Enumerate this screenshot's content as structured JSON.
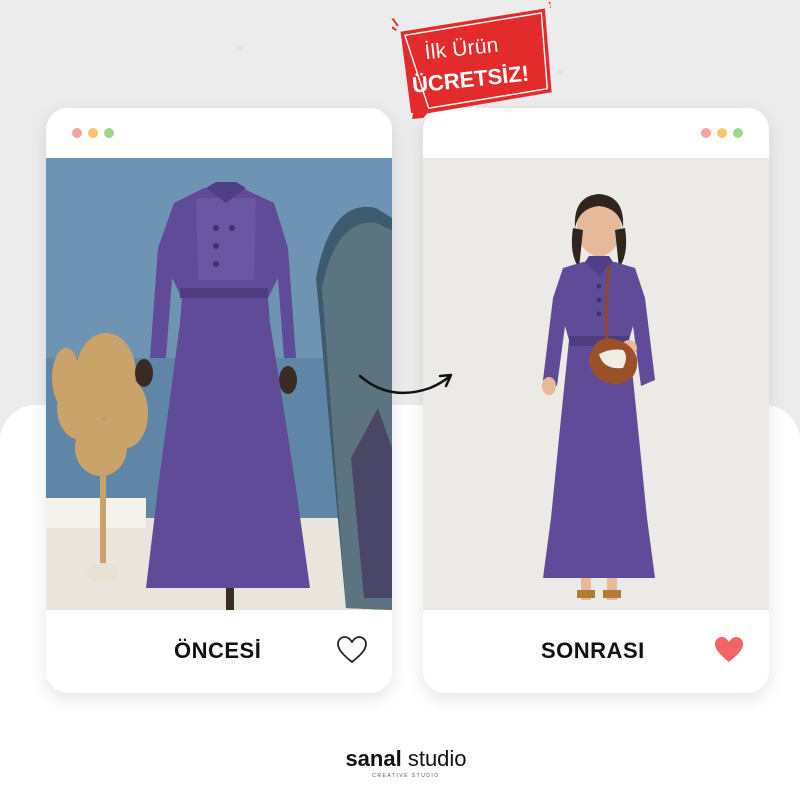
{
  "badge": {
    "line1": "İlk Ürün",
    "line2": "ÜCRETSİZ!",
    "color": "#e32b2b"
  },
  "before_card": {
    "label": "ÖNCESİ",
    "heart_icon": "heart-outline-icon"
  },
  "after_card": {
    "label": "SONRASI",
    "heart_icon": "heart-filled-icon",
    "heart_color": "#f26565"
  },
  "logo": {
    "part1": "sanal",
    "part2": "studio",
    "tagline": "CREATIVE STUDIO"
  },
  "colors": {
    "dress": "#5f4b97",
    "accent_red": "#e32b2b"
  }
}
